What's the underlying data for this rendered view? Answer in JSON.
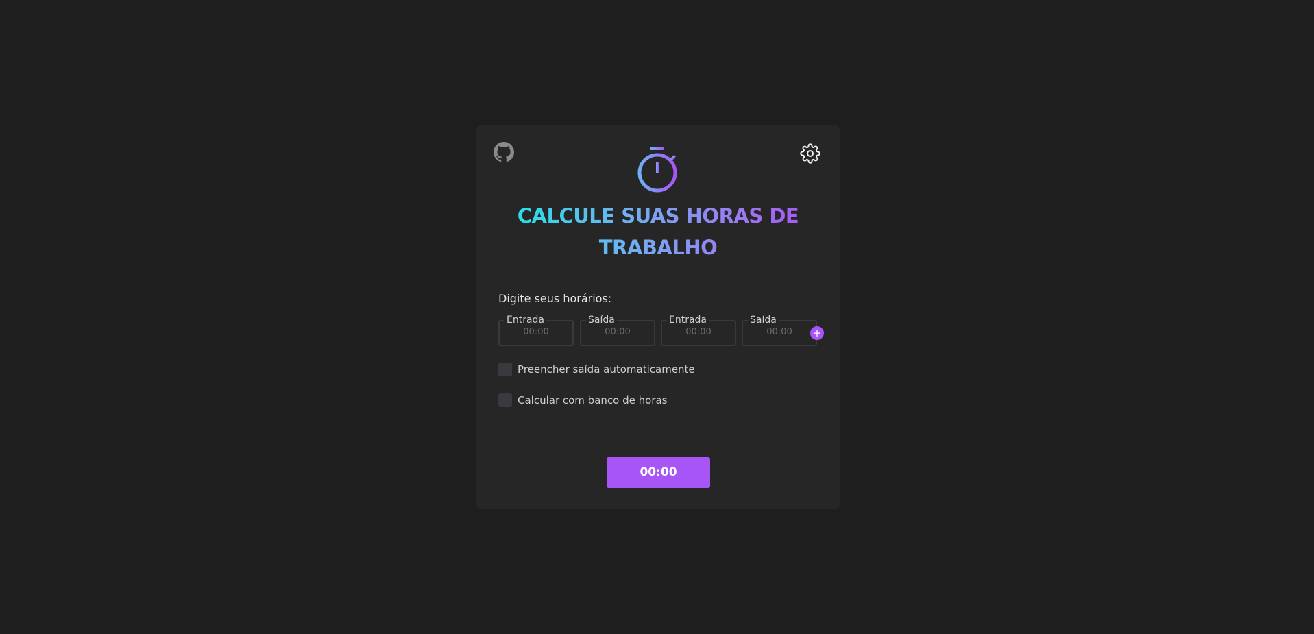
{
  "header": {
    "title": "CALCULE SUAS HORAS DE TRABALHO",
    "github_icon": "github-icon",
    "settings_icon": "gear-icon",
    "logo_icon": "stopwatch-icon"
  },
  "form": {
    "prompt": "Digite seus horários:",
    "fields": [
      {
        "label": "Entrada",
        "placeholder": "00:00"
      },
      {
        "label": "Saída",
        "placeholder": "00:00"
      },
      {
        "label": "Entrada",
        "placeholder": "00:00"
      },
      {
        "label": "Saída",
        "placeholder": "00:00"
      }
    ],
    "add_label": "+",
    "options": [
      {
        "label": "Preencher saída automaticamente",
        "checked": false
      },
      {
        "label": "Calcular com banco de horas",
        "checked": false
      }
    ]
  },
  "result": {
    "value": "00:00"
  },
  "colors": {
    "accent": "#a855f7",
    "gradient_start": "#22e5e5",
    "gradient_end": "#a855f7",
    "background": "#1e1e1e",
    "card": "#262626"
  }
}
